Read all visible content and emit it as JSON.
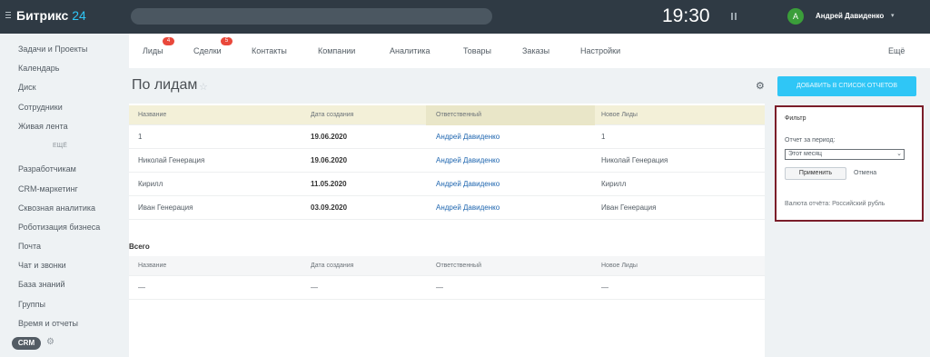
{
  "header": {
    "logo_text": "Битрикс",
    "logo_number": "24",
    "time": "19:30",
    "user_initial": "А",
    "user_name": "Андрей Давиденко"
  },
  "sidebar": {
    "items": [
      "Задачи и Проекты",
      "Календарь",
      "Диск",
      "Сотрудники",
      "Живая лента",
      "Разработчикам",
      "CRM-маркетинг",
      "Сквозная аналитика",
      "Роботизация бизнеса",
      "Почта",
      "Чат и звонки",
      "База знаний",
      "Группы",
      "Время и отчеты"
    ],
    "more_label": "ЕЩЁ",
    "crm_label": "CRM"
  },
  "tabs": {
    "items": [
      {
        "label": "Лиды",
        "badge": "4"
      },
      {
        "label": "Сделки",
        "badge": "5"
      },
      {
        "label": "Контакты",
        "badge": ""
      },
      {
        "label": "Компании",
        "badge": ""
      },
      {
        "label": "Аналитика",
        "badge": ""
      },
      {
        "label": "Товары",
        "badge": ""
      },
      {
        "label": "Заказы",
        "badge": ""
      },
      {
        "label": "Настройки",
        "badge": ""
      }
    ],
    "more_label": "Ещё"
  },
  "page": {
    "title": "По лидам"
  },
  "report": {
    "columns": [
      "Название",
      "Дата создания",
      "Ответственный",
      "Новое Лиды"
    ],
    "rows": [
      [
        "1",
        "19.06.2020",
        "Андрей Давиденко",
        "1"
      ],
      [
        "Николай Генерация",
        "19.06.2020",
        "Андрей Давиденко",
        "Николай Генерация"
      ],
      [
        "Кирилл",
        "11.05.2020",
        "Андрей Давиденко",
        "Кирилл"
      ],
      [
        "Иван Генерация",
        "03.09.2020",
        "Андрей Давиденко",
        "Иван Генерация"
      ]
    ],
    "total_label": "Всего",
    "total_columns": [
      "Название",
      "Дата создания",
      "Ответственный",
      "Новое Лиды"
    ],
    "total_row": [
      "—",
      "—",
      "—",
      "—"
    ]
  },
  "right_panel": {
    "cta_label": "ДОБАВИТЬ В СПИСОК ОТЧЕТОВ",
    "filter_title": "Фильтр",
    "period_label": "Отчет за период:",
    "period_value": "Этот месяц",
    "apply_label": "Применить",
    "cancel_label": "Отмена",
    "currency_note": "Валюта отчёта: Российский рубль"
  }
}
